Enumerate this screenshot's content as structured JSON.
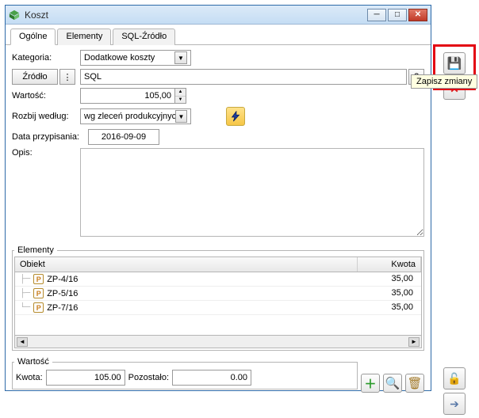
{
  "window": {
    "title": "Koszt"
  },
  "tabs": {
    "items": [
      "Ogólne",
      "Elementy",
      "SQL-Źródło"
    ]
  },
  "labels": {
    "kategoria": "Kategoria:",
    "zrodlo_btn": "Źródło",
    "wartosc": "Wartość:",
    "rozbij": "Rozbij według:",
    "data_przyp": "Data przypisania:",
    "opis": "Opis:"
  },
  "fields": {
    "kategoria": "Dodatkowe koszty",
    "zrodlo": "SQL",
    "wartosc": "105,00",
    "rozbij": "wg zleceń produkcyjnych",
    "data": "2016-09-09"
  },
  "grid": {
    "legend": "Elementy",
    "columns": {
      "obiekt": "Obiekt",
      "kwota": "Kwota"
    },
    "rows": [
      {
        "obj": "ZP-4/16",
        "kw": "35,00"
      },
      {
        "obj": "ZP-5/16",
        "kw": "35,00"
      },
      {
        "obj": "ZP-7/16",
        "kw": "35,00"
      }
    ]
  },
  "wartosc_panel": {
    "legend": "Wartość",
    "kwota_label": "Kwota:",
    "kwota": "105.00",
    "pozostalo_label": "Pozostało:",
    "pozostalo": "0.00"
  },
  "tooltip": "Zapisz zmiany",
  "help_btn": "?"
}
